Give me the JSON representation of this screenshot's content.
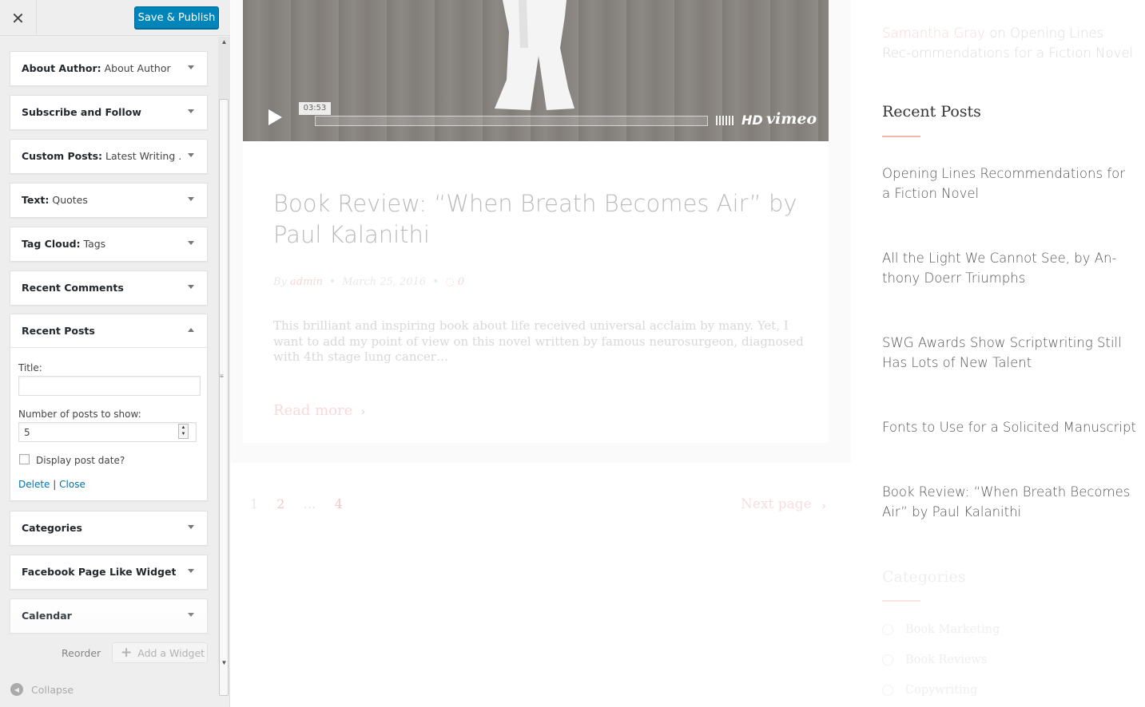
{
  "customizer": {
    "close_icon": "close-icon",
    "publish_label": "Save & Publish",
    "widgets": [
      {
        "name": "About Author:",
        "subtitle": " About Author"
      },
      {
        "name": "Subscribe and Follow",
        "subtitle": ""
      },
      {
        "name": "Custom Posts:",
        "subtitle": " Latest Writing ..."
      },
      {
        "name": "Text:",
        "subtitle": " Quotes"
      },
      {
        "name": "Tag Cloud:",
        "subtitle": " Tags"
      },
      {
        "name": "Recent Comments",
        "subtitle": ""
      },
      {
        "name": "Recent Posts",
        "subtitle": ""
      },
      {
        "name": "Categories",
        "subtitle": ""
      },
      {
        "name": "Facebook Page Like Widget",
        "subtitle": ""
      },
      {
        "name": "Calendar",
        "subtitle": ""
      }
    ],
    "recent_posts_form": {
      "title_label": "Title:",
      "title_value": "",
      "number_label": "Number of posts to show:",
      "number_value": "5",
      "display_date_label": "Display post date?",
      "display_date_checked": false,
      "delete_label": "Delete",
      "separator": "|",
      "close_label": "Close"
    },
    "reorder_label": "Reorder",
    "add_widget_label": "Add a Widget",
    "collapse_label": "Collapse",
    "accent_color": "#0085ba"
  },
  "preview": {
    "video": {
      "time": "03:53",
      "hd_label": "HD",
      "brand": "vimeo"
    },
    "post": {
      "title": "Book Review: “When Breath Becomes Air” by Paul Kalanithi",
      "meta_by": "By",
      "meta_author": "admin",
      "meta_sep1": "•",
      "meta_date": "March 25, 2016",
      "meta_sep2": "•",
      "meta_comments": "0",
      "excerpt": "This brilliant and inspiring book about life received universal acclaim by many. Yet, I want to add my point of view on this novel written by famous neurosurgeon, diagnosed with 4th stage lung cancer…",
      "read_more": "Read more"
    },
    "pagination": {
      "pages": [
        "1",
        "2",
        "…",
        "4"
      ],
      "current": "2",
      "next_label": "Next page"
    },
    "sidebar": {
      "recent_comment": {
        "author": "Samantha Gray",
        "on": " on ",
        "post": "Opening Lines Rec-ommendations for a Fiction Novel"
      },
      "recent_posts_heading": "Recent Posts",
      "recent_posts": [
        "Opening Lines Recommendations for a Fiction Novel",
        "All the Light We Cannot See, by An-thony Doerr Triumphs",
        "SWG Awards Show Scriptwriting Still Has Lots of New Talent",
        "Fonts to Use for a Solicited Manuscript",
        "Book Review: “When Breath Becomes Air” by Paul Kalanithi"
      ],
      "categories_heading": "Categories",
      "categories": [
        "Book Marketing",
        "Book Reviews",
        "Copywriting"
      ]
    }
  }
}
